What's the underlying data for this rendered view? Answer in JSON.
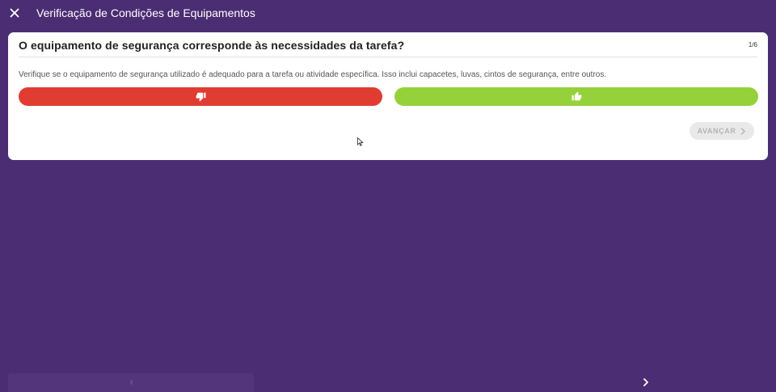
{
  "app": {
    "title": "Verificação de Condições de Equipamentos"
  },
  "question": {
    "title": "O equipamento de segurança corresponde às necessidades da tarefa?",
    "progress": "1/6",
    "description": "Verifique se o equipamento de segurança utilizado é adequado para a tarefa ou atividade específica. Isso inclui capacetes, luvas, cintos de segurança, entre outros."
  },
  "buttons": {
    "no_icon": "thumbs-down-icon",
    "yes_icon": "thumbs-up-icon",
    "next_label": "AVANÇAR"
  },
  "colors": {
    "background": "#4a2d72",
    "no": "#e03c31",
    "yes": "#95d13a",
    "disabled": "#e9e9e9"
  }
}
